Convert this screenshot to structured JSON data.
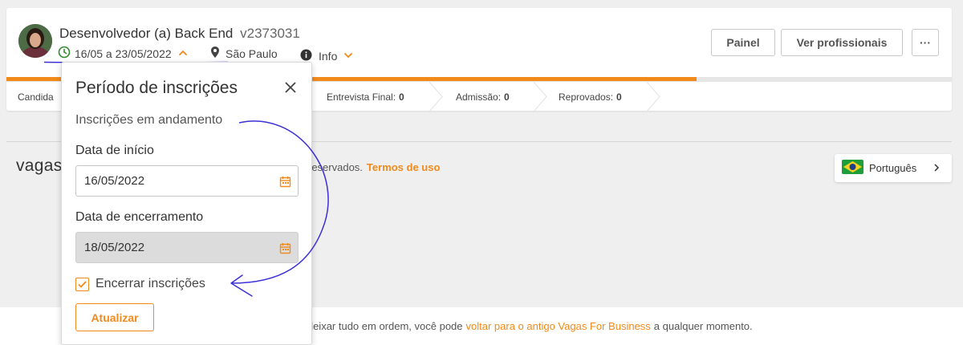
{
  "job": {
    "title": "Desenvolvedor (a) Back End",
    "code": "v2373031",
    "period": "16/05 a 23/05/2022",
    "location": "São Paulo",
    "info_label": "Info",
    "progress_fraction": 0.73
  },
  "header_actions": {
    "panel_label": "Painel",
    "professionals_label": "Ver profissionais",
    "more_label": "···"
  },
  "stages": [
    {
      "label": "Candida",
      "count": ""
    },
    {
      "label": "Entrevista Final:",
      "count": "0"
    },
    {
      "label": "Admissão:",
      "count": "0"
    },
    {
      "label": "Reprovados:",
      "count": "0"
    }
  ],
  "footer": {
    "logo": "vagas",
    "rights_text": "reservados.",
    "terms_link": "Termos de uso",
    "language": "Português"
  },
  "bottom_bar": {
    "text_before": "a deixar tudo em ordem, você pode",
    "link": "voltar para o antigo Vagas For Business",
    "text_after": "a qualquer momento."
  },
  "popover": {
    "title": "Período de inscrições",
    "status": "Inscrições em andamento",
    "start_label": "Data de início",
    "start_value": "16/05/2022",
    "end_label": "Data de encerramento",
    "end_value": "18/05/2022",
    "checkbox_label": "Encerrar inscrições",
    "checkbox_checked": true,
    "submit_label": "Atualizar"
  },
  "colors": {
    "accent": "#f28a1b",
    "success": "#2e8b2e",
    "annotation": "#3b2fd6"
  }
}
